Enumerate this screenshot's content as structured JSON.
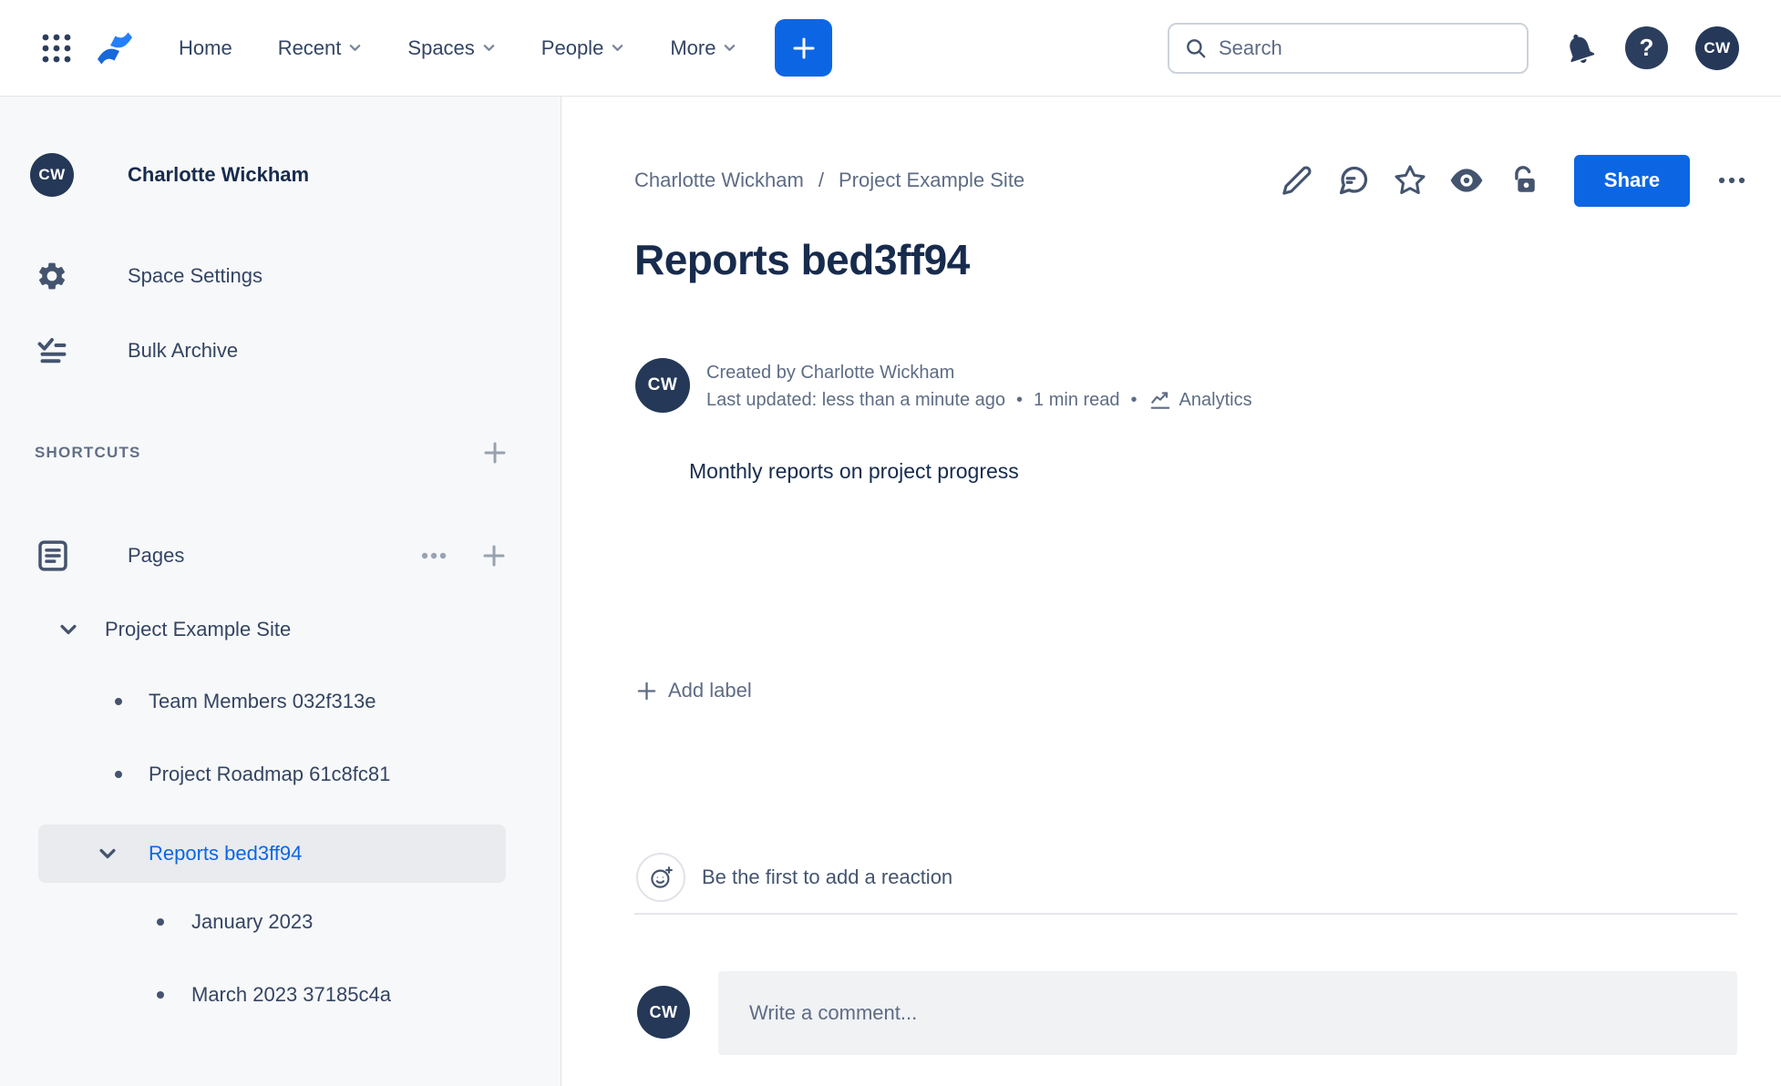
{
  "topbar": {
    "nav_items": [
      {
        "label": "Home",
        "has_dropdown": false
      },
      {
        "label": "Recent",
        "has_dropdown": true
      },
      {
        "label": "Spaces",
        "has_dropdown": true
      },
      {
        "label": "People",
        "has_dropdown": true
      },
      {
        "label": "More",
        "has_dropdown": true
      }
    ],
    "search": {
      "placeholder": "Search"
    },
    "avatar_initials": "CW"
  },
  "icons": {
    "help_glyph": "?"
  },
  "sidebar": {
    "space_avatar_initials": "CW",
    "space_name": "Charlotte Wickham",
    "menu": [
      {
        "label": "Space Settings",
        "icon": "gear-icon"
      },
      {
        "label": "Bulk Archive",
        "icon": "bulk-archive-icon"
      }
    ],
    "shortcuts_label": "SHORTCUTS",
    "pages_label": "Pages",
    "tree": [
      {
        "label": "Project Example Site",
        "expanded": true,
        "selected": false
      },
      {
        "label": "Team Members 032f313e",
        "selected": false
      },
      {
        "label": "Project Roadmap 61c8fc81",
        "selected": false
      },
      {
        "label": "Reports bed3ff94",
        "expanded": true,
        "selected": true
      },
      {
        "label": "January 2023",
        "selected": false
      },
      {
        "label": "March 2023 37185c4a",
        "selected": false
      }
    ]
  },
  "content": {
    "breadcrumbs": [
      {
        "label": "Charlotte Wickham"
      },
      {
        "label": "Project Example Site"
      }
    ],
    "breadcrumb_separator": "/",
    "share_label": "Share",
    "title": "Reports bed3ff94",
    "byline": {
      "avatar_initials": "CW",
      "created_by": "Created by Charlotte Wickham",
      "last_updated": "Last updated: less than a minute ago",
      "separator": "•",
      "read_time": "1 min read",
      "analytics_label": "Analytics"
    },
    "body_text": "Monthly reports on project progress",
    "add_label_text": "Add label",
    "reaction_prompt": "Be the first to add a reaction",
    "comment": {
      "avatar_initials": "CW",
      "placeholder": "Write a comment..."
    }
  },
  "colors": {
    "accent_blue": "#0C66E4",
    "logo_blue": "#2380FB",
    "logo_blue_dark": "#1868DB",
    "navy": "#253858",
    "icon_slate": "#44546F",
    "text_dark": "#172B4D",
    "text_gray": "#5E6C84",
    "selected_bg": "#E9EBEE",
    "selected_text": "#0C66E4",
    "sidebar_bg": "#F7F8F9"
  }
}
